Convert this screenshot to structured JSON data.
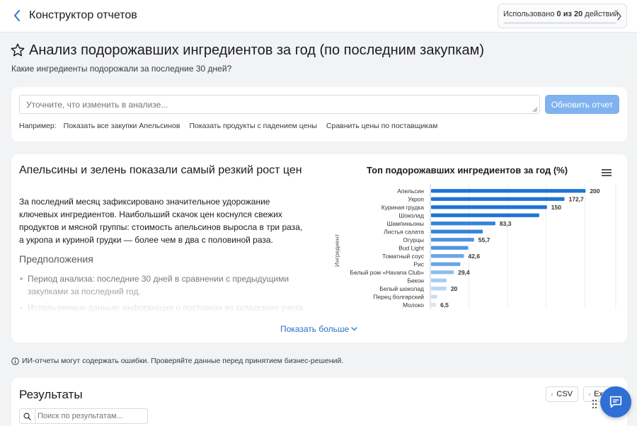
{
  "header": {
    "app_title": "Конструктор отчетов",
    "usage_prefix": "Использовано ",
    "usage_count": "0 из 20",
    "usage_suffix": " действий",
    "usage_used": 0,
    "usage_total": 20
  },
  "page": {
    "title": "Анализ подорожавших ингредиентов за год (по последним закупкам)",
    "subtitle": "Какие ингредиенты подорожали за последние 30 дней?"
  },
  "refine": {
    "placeholder": "Уточните, что изменить в анализе...",
    "button": "Обновить отчет",
    "examples_label": "Например:",
    "examples": [
      "Показать все закупки Апельсинов",
      "Показать продукты с падением цены",
      "Сравнить цены по поставщикам"
    ]
  },
  "analysis": {
    "heading": "Апельсины и зелень показали самый резкий рост цен",
    "body": "За последний месяц зафиксировано значительное удорожание ключевых ингредиентов. Наибольший скачок цен коснулся свежих продуктов и мясной группы: стоимость апельсинов выросла в три раза, а укропа и куриной грудки — более чем в два с половиной раза.",
    "assumptions_title": "Предположения",
    "assumptions": [
      "Период анализа: последние 30 дней в сравнении с предыдущими закупками за последний год.",
      "Используемые данные: информация о поставках из складского учета."
    ],
    "show_more": "Показать больше"
  },
  "chart_data": {
    "type": "bar",
    "orientation": "horizontal",
    "title": "Топ подорожавших ингредиентов за год (%)",
    "ylabel": "Ингредиент",
    "categories": [
      "Апельсин",
      "Укроп",
      "Куриная грудка",
      "Шоколад",
      "Шампиньоны",
      "Листья салата",
      "Огурцы",
      "Bud Light",
      "Томатный соус",
      "Рис",
      "Белый ром «Havana Club»",
      "Бекон",
      "Белый шоколад",
      "Перец болгарский",
      "Молоко"
    ],
    "values": [
      200,
      172.7,
      150,
      140,
      83.3,
      67,
      55.7,
      48,
      42.6,
      38,
      29.4,
      20,
      20,
      8,
      6.5
    ],
    "data_labels": [
      "200",
      "172,7",
      "150",
      "",
      "83,3",
      "",
      "55,7",
      "",
      "42,6",
      "",
      "29,4",
      "",
      "20",
      "",
      "6,5"
    ],
    "xlim": [
      0,
      240
    ],
    "grid": true,
    "colors": [
      "#1f74d4",
      "#1f74d4",
      "#1f74d4",
      "#1f74d4",
      "#3583dc",
      "#3583dc",
      "#4e93e2",
      "#4e93e2",
      "#6aa5e8",
      "#6aa5e8",
      "#8dbdef",
      "#a6ccf3",
      "#b7d6f5",
      "#c6def7",
      "#d3e6f9"
    ]
  },
  "disclaimer": "ИИ-отчеты могут содержать ошибки. Проверяйте данные перед принятием бизнес-решений.",
  "results": {
    "title": "Результаты",
    "csv": "CSV",
    "excel": "Excel",
    "search_placeholder": "Поиск по результатам..."
  },
  "icons": {
    "back": "chevron-left-icon",
    "star": "star-outline-icon",
    "menu": "hamburger-menu-icon",
    "info": "info-circle-icon",
    "file": "file-icon",
    "search": "search-icon",
    "chat": "chat-bubble-icon",
    "accent": "#2f6fd6"
  }
}
